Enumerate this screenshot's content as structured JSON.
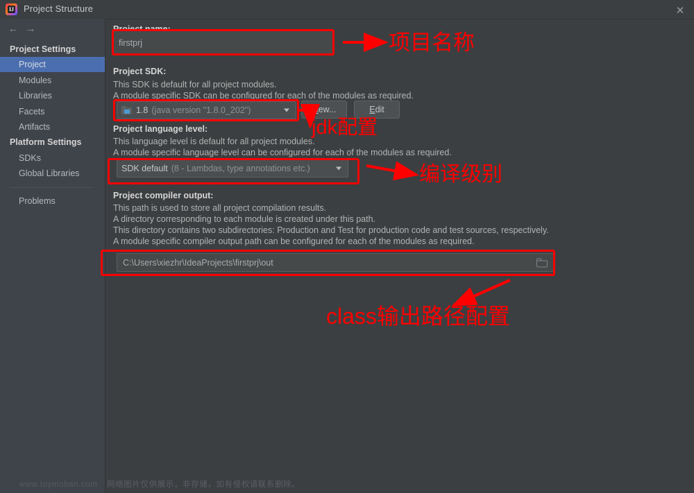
{
  "window": {
    "title": "Project Structure",
    "app_icon": "intellij-idea-icon",
    "close_label": "✕"
  },
  "nav": {
    "back_icon": "←",
    "forward_icon": "→"
  },
  "sidebar": {
    "groups": [
      {
        "label": "Project Settings"
      },
      {
        "label": "Platform Settings"
      }
    ],
    "project_settings_items": [
      {
        "label": "Project",
        "selected": true
      },
      {
        "label": "Modules",
        "selected": false
      },
      {
        "label": "Libraries",
        "selected": false
      },
      {
        "label": "Facets",
        "selected": false
      },
      {
        "label": "Artifacts",
        "selected": false
      }
    ],
    "platform_settings_items": [
      {
        "label": "SDKs",
        "selected": false
      },
      {
        "label": "Global Libraries",
        "selected": false
      }
    ],
    "bottom_items": [
      {
        "label": "Problems",
        "selected": false
      }
    ]
  },
  "main": {
    "project_name": {
      "label": "Project name:",
      "value": "firstprj"
    },
    "project_sdk": {
      "label": "Project SDK:",
      "desc_line1": "This SDK is default for all project modules.",
      "desc_line2": "A module specific SDK can be configured for each of the modules as required.",
      "selected_value": "1.8 (java version \"1.8.0_202\")",
      "selected_value_main": "1.8",
      "selected_value_dim": "(java version \"1.8.0_202\")",
      "icon": "jdk-folder-icon",
      "new_button": {
        "mnemonic": "N",
        "rest": "ew..."
      },
      "edit_button": {
        "mnemonic": "E",
        "rest": "dit"
      }
    },
    "language_level": {
      "label": "Project language level:",
      "desc_line1": "This language level is default for all project modules.",
      "desc_line2": "A module specific language level can be configured for each of the modules as required.",
      "selected_value_main": "SDK default",
      "selected_value_dim": "(8 - Lambdas, type annotations etc.)"
    },
    "compiler_output": {
      "label": "Project compiler output:",
      "desc_line1": "This path is used to store all project compilation results.",
      "desc_line2": "A directory corresponding to each module is created under this path.",
      "desc_line3": "This directory contains two subdirectories: Production and Test for production code and test sources, respectively.",
      "desc_line4": "A module specific compiler output path can be configured for each of the modules as required.",
      "value": "C:\\Users\\xiezhr\\IdeaProjects\\firstprj\\out",
      "browse_icon": "folder-browse-icon"
    }
  },
  "annotations": {
    "color": "#fe0000",
    "labels": [
      {
        "text": "项目名称",
        "name": "annotation-project-name"
      },
      {
        "text": "jdk配置",
        "name": "annotation-jdk-config"
      },
      {
        "text": "编译级别",
        "name": "annotation-language-level"
      },
      {
        "text": "class输出路径配置",
        "name": "annotation-output-path"
      }
    ]
  },
  "watermark": {
    "site": "www.toymoban.com",
    "notice": "网络图片仅供展示，非存储，如有侵权请联系删除。"
  }
}
